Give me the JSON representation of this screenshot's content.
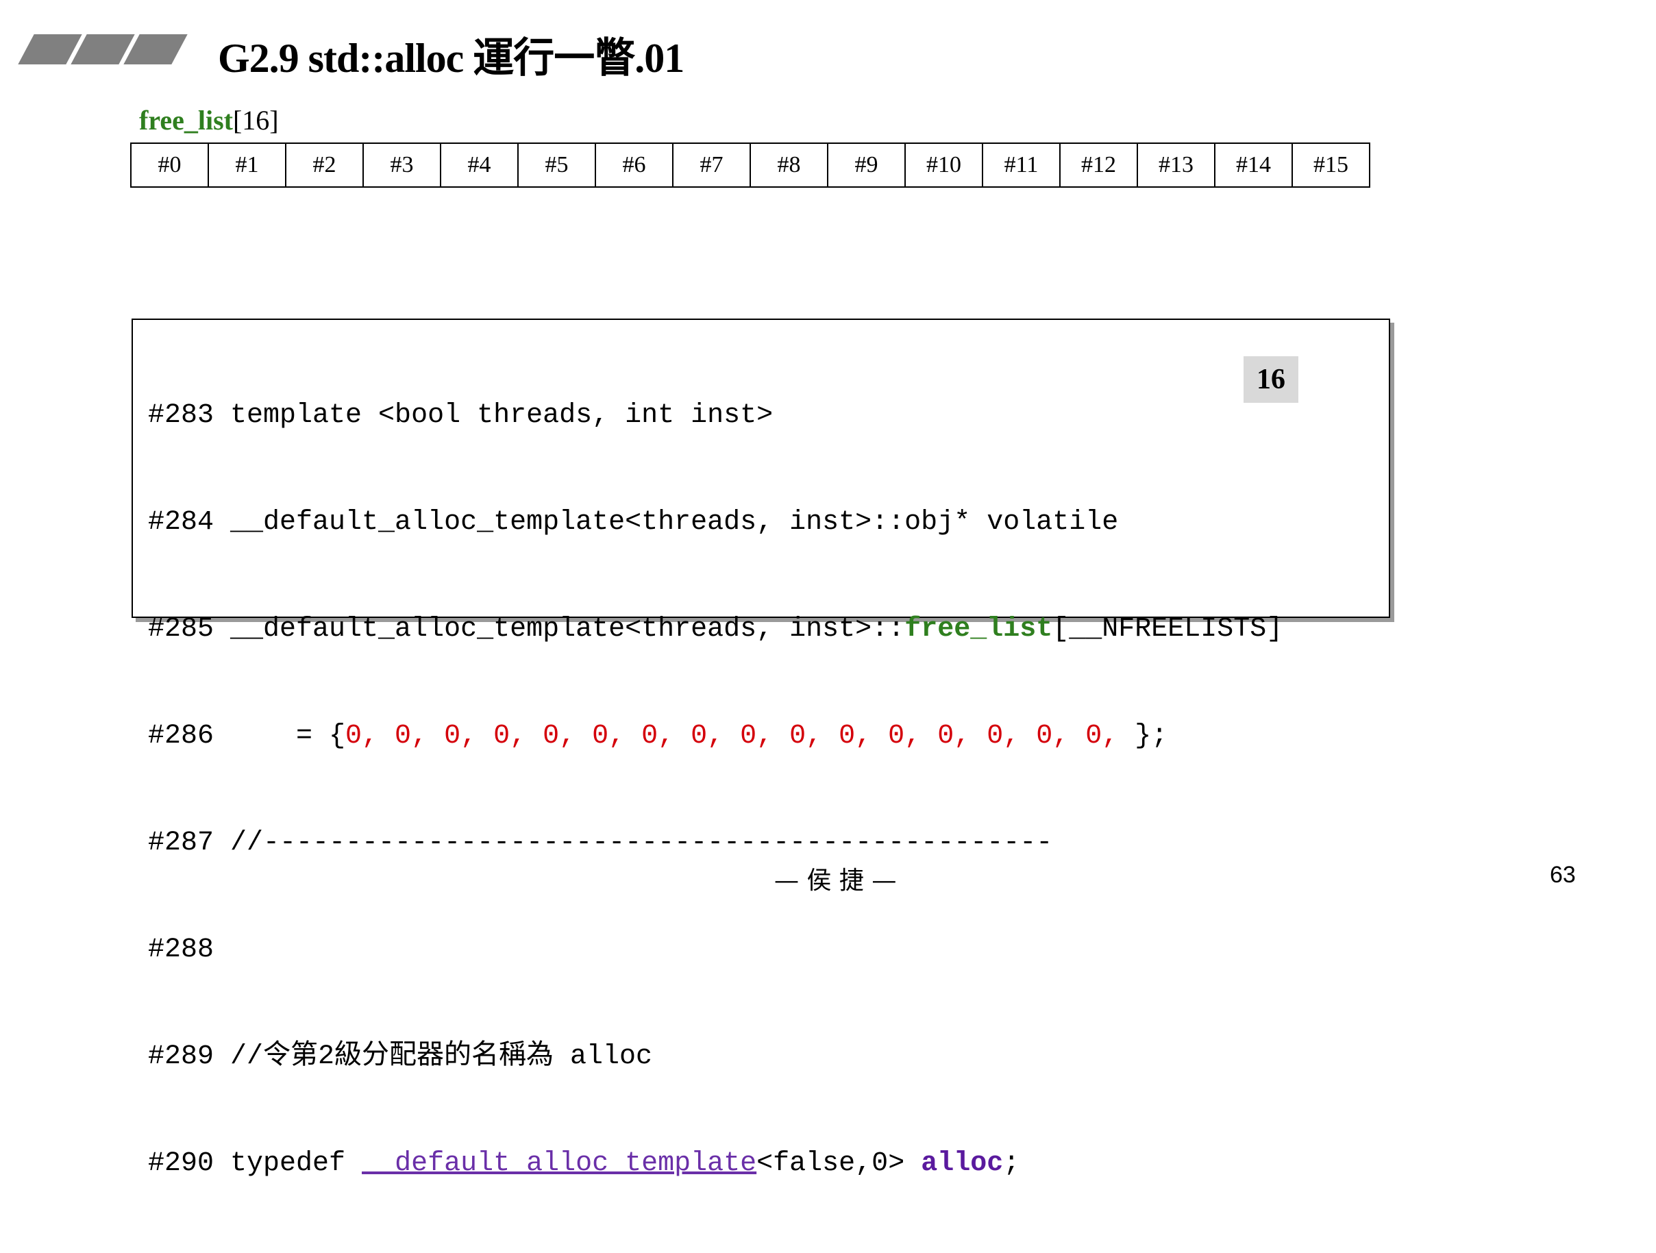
{
  "slide": {
    "title": "G2.9 std::alloc 運行一瞥.01",
    "footer": "— 侯 捷 —",
    "page_number": "63"
  },
  "free_list": {
    "name": "free_list",
    "size_label": "[16]",
    "slots": [
      "#0",
      "#1",
      "#2",
      "#3",
      "#4",
      "#5",
      "#6",
      "#7",
      "#8",
      "#9",
      "#10",
      "#11",
      "#12",
      "#13",
      "#14",
      "#15"
    ]
  },
  "code": {
    "badge": "16",
    "lines": {
      "l283": {
        "num": "#283",
        "text": " template <bool threads, int inst>"
      },
      "l284": {
        "num": "#284",
        "text": " __default_alloc_template<threads, inst>::obj* volatile"
      },
      "l285": {
        "num": "#285",
        "pre": " __default_alloc_template<threads, inst>::",
        "hl": "free_list",
        "post": "[__NFREELISTS]"
      },
      "l286": {
        "num": "#286",
        "pre": "     = {",
        "zeros": "0, 0, 0, 0, 0, 0, 0, 0, 0, 0, 0, 0, 0, 0, 0, 0,",
        "post": " };"
      },
      "l287": {
        "num": "#287",
        "text": " //------------------------------------------------"
      },
      "l288": {
        "num": "#288",
        "text": ""
      },
      "l289": {
        "num": "#289",
        "text": " //令第2級分配器的名稱為 alloc"
      },
      "l290": {
        "num": "#290",
        "pre": " typedef ",
        "type": "__default_alloc_template",
        "mid": "<false,0> ",
        "name": "alloc",
        "post": ";"
      }
    }
  }
}
